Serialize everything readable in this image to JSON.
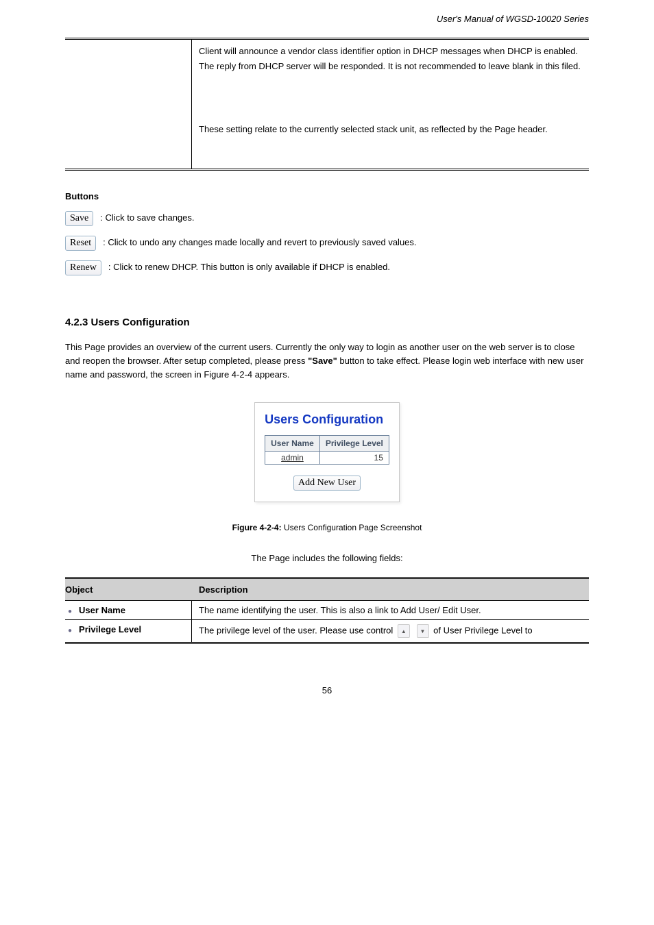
{
  "manual_title": "User's Manual of WGSD-10020 Series",
  "top_table": {
    "left": "",
    "right_paragraphs": [
      "Client will announce a vendor class identifier option in DHCP messages when DHCP is enabled. The reply from DHCP server will be responded. It is not recommended to leave blank in this filed.",
      "These setting relate to the currently selected stack unit, as reflected by the Page header."
    ]
  },
  "buttons": {
    "heading": "Buttons",
    "save": {
      "label": "Save",
      "desc": ": Click to save changes."
    },
    "reset": {
      "label": "Reset",
      "desc": ": Click to undo any changes made locally and revert to previously saved values."
    },
    "renew": {
      "label": "Renew",
      "desc": ": Click to renew DHCP. This button is only available if DHCP is enabled."
    }
  },
  "section_4_2_3": {
    "no": "4.2.3",
    "title": "Users Configuration",
    "para1": "This Page provides an overview of the current users. Currently the only way to login as another user on the web server is to close and reopen the browser. After setup completed, please press ",
    "para1_bold": "\"Save\"",
    "para1_tail": " button to take effect. Please login web interface with new user name and password, the screen in Figure 4-2-4 appears.",
    "fig_caption": "Figure 4-2-4:",
    "fig_desc": "Users Configuration Page Screenshot"
  },
  "users_snippet": {
    "title": "Users Configuration",
    "columns": [
      "User Name",
      "Privilege Level"
    ],
    "rows": [
      {
        "username": "admin",
        "level": "15"
      }
    ],
    "add_button": "Add New User"
  },
  "page_caption": "The Page includes the following fields:",
  "param_table": {
    "head_object": "Object",
    "head_desc": "Description",
    "rows": [
      {
        "object": "User Name",
        "desc": "The name identifying the user. This is also a link to Add User/ Edit User."
      },
      {
        "object": "Privilege Level",
        "desc_pre": "The privilege level of the user. Please use control ",
        "desc_post": " of User Privilege Level to"
      }
    ]
  },
  "page_number": "56"
}
